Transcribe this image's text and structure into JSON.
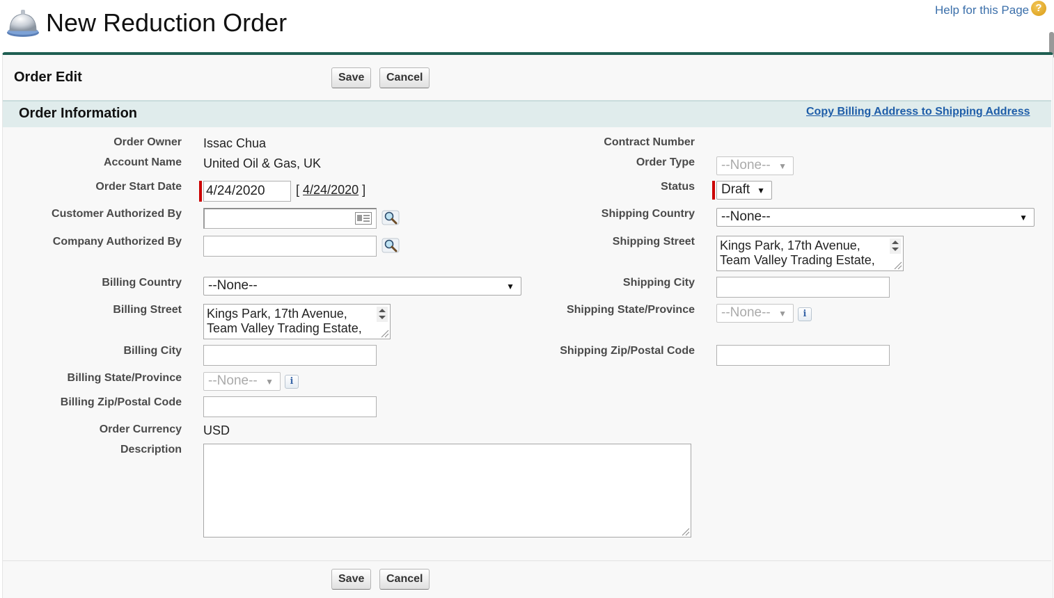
{
  "page": {
    "title": "New Reduction Order",
    "help_link": "Help for this Page",
    "help_icon": "help-question-icon"
  },
  "page_block": {
    "title": "Order Edit",
    "save_label": "Save",
    "cancel_label": "Cancel"
  },
  "section": {
    "title": "Order Information",
    "copy_link": "Copy Billing Address to Shipping Address"
  },
  "left_fields": {
    "order_owner": {
      "label": "Order Owner",
      "value": "Issac Chua"
    },
    "account_name": {
      "label": "Account Name",
      "value": "United Oil & Gas, UK"
    },
    "order_start_date": {
      "label": "Order Start Date",
      "value": "4/24/2020",
      "today_link": "4/24/2020",
      "bracket_open": "[",
      "bracket_close": "]"
    },
    "customer_authorized_by": {
      "label": "Customer Authorized By",
      "value": ""
    },
    "company_authorized_by": {
      "label": "Company Authorized By",
      "value": ""
    },
    "billing_country": {
      "label": "Billing Country",
      "value": "--None--"
    },
    "billing_street": {
      "label": "Billing Street",
      "line1": "Kings Park, 17th Avenue,",
      "line2": "Team Valley Trading Estate,"
    },
    "billing_city": {
      "label": "Billing City",
      "value": ""
    },
    "billing_state": {
      "label": "Billing State/Province",
      "value": "--None--"
    },
    "billing_zip": {
      "label": "Billing Zip/Postal Code",
      "value": ""
    },
    "order_currency": {
      "label": "Order Currency",
      "value": "USD"
    },
    "description": {
      "label": "Description",
      "value": ""
    }
  },
  "right_fields": {
    "contract_number": {
      "label": "Contract Number",
      "value": ""
    },
    "order_type": {
      "label": "Order Type",
      "value": "--None--"
    },
    "status": {
      "label": "Status",
      "value": "Draft"
    },
    "shipping_country": {
      "label": "Shipping Country",
      "value": "--None--"
    },
    "shipping_street": {
      "label": "Shipping Street",
      "line1": "Kings Park, 17th Avenue,",
      "line2": "Team Valley Trading Estate,"
    },
    "shipping_city": {
      "label": "Shipping City",
      "value": ""
    },
    "shipping_state": {
      "label": "Shipping State/Province",
      "value": "--None--"
    },
    "shipping_zip": {
      "label": "Shipping Zip/Postal Code",
      "value": ""
    }
  },
  "glyphs": {
    "caret": "▼",
    "info": "i",
    "help": "?"
  },
  "colors": {
    "header_bar": "#1f5f52",
    "section_bg": "#e0ecec",
    "link": "#1e5da8",
    "required": "#cc0000"
  }
}
